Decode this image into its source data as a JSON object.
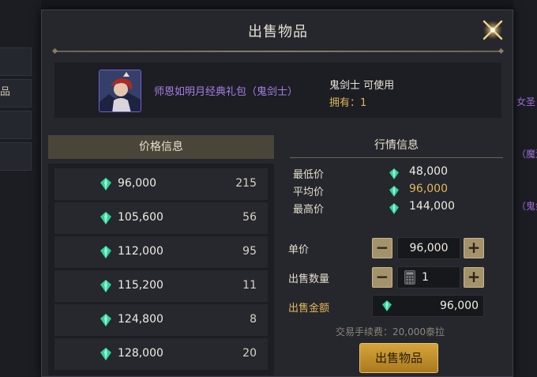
{
  "dialog": {
    "title": "出售物品",
    "close_icon": "sparkle-close-icon"
  },
  "background": {
    "left_tab_label": "品",
    "right_items": [
      "女圣",
      "（魔法",
      "（鬼剑"
    ]
  },
  "item": {
    "name": "师恩如明月经典礼包（鬼剑士）",
    "class_usable": "鬼剑士 可使用",
    "owned_label": "拥有：",
    "owned_count": "1"
  },
  "price_panel": {
    "header": "价格信息",
    "rows": [
      {
        "price": "96,000",
        "count": "215"
      },
      {
        "price": "105,600",
        "count": "56"
      },
      {
        "price": "112,000",
        "count": "95"
      },
      {
        "price": "115,200",
        "count": "11"
      },
      {
        "price": "124,800",
        "count": "8"
      },
      {
        "price": "128,000",
        "count": "20"
      }
    ]
  },
  "market_panel": {
    "header": "行情信息",
    "lowest_label": "最低价",
    "lowest_value": "48,000",
    "average_label": "平均价",
    "average_value": "96,000",
    "highest_label": "最高价",
    "highest_value": "144,000"
  },
  "form": {
    "unit_price_label": "单价",
    "unit_price_value": "96,000",
    "quantity_label": "出售数量",
    "quantity_value": "1",
    "total_label": "出售金额",
    "total_value": "96,000",
    "minus_symbol": "−",
    "plus_symbol": "+",
    "fee_text": "交易手续费：20,000泰拉",
    "sell_button": "出售物品"
  },
  "colors": {
    "gold_accent": "#e3b75a",
    "item_name_purple": "#a97ee6",
    "gem_green": "#2fd39a"
  }
}
